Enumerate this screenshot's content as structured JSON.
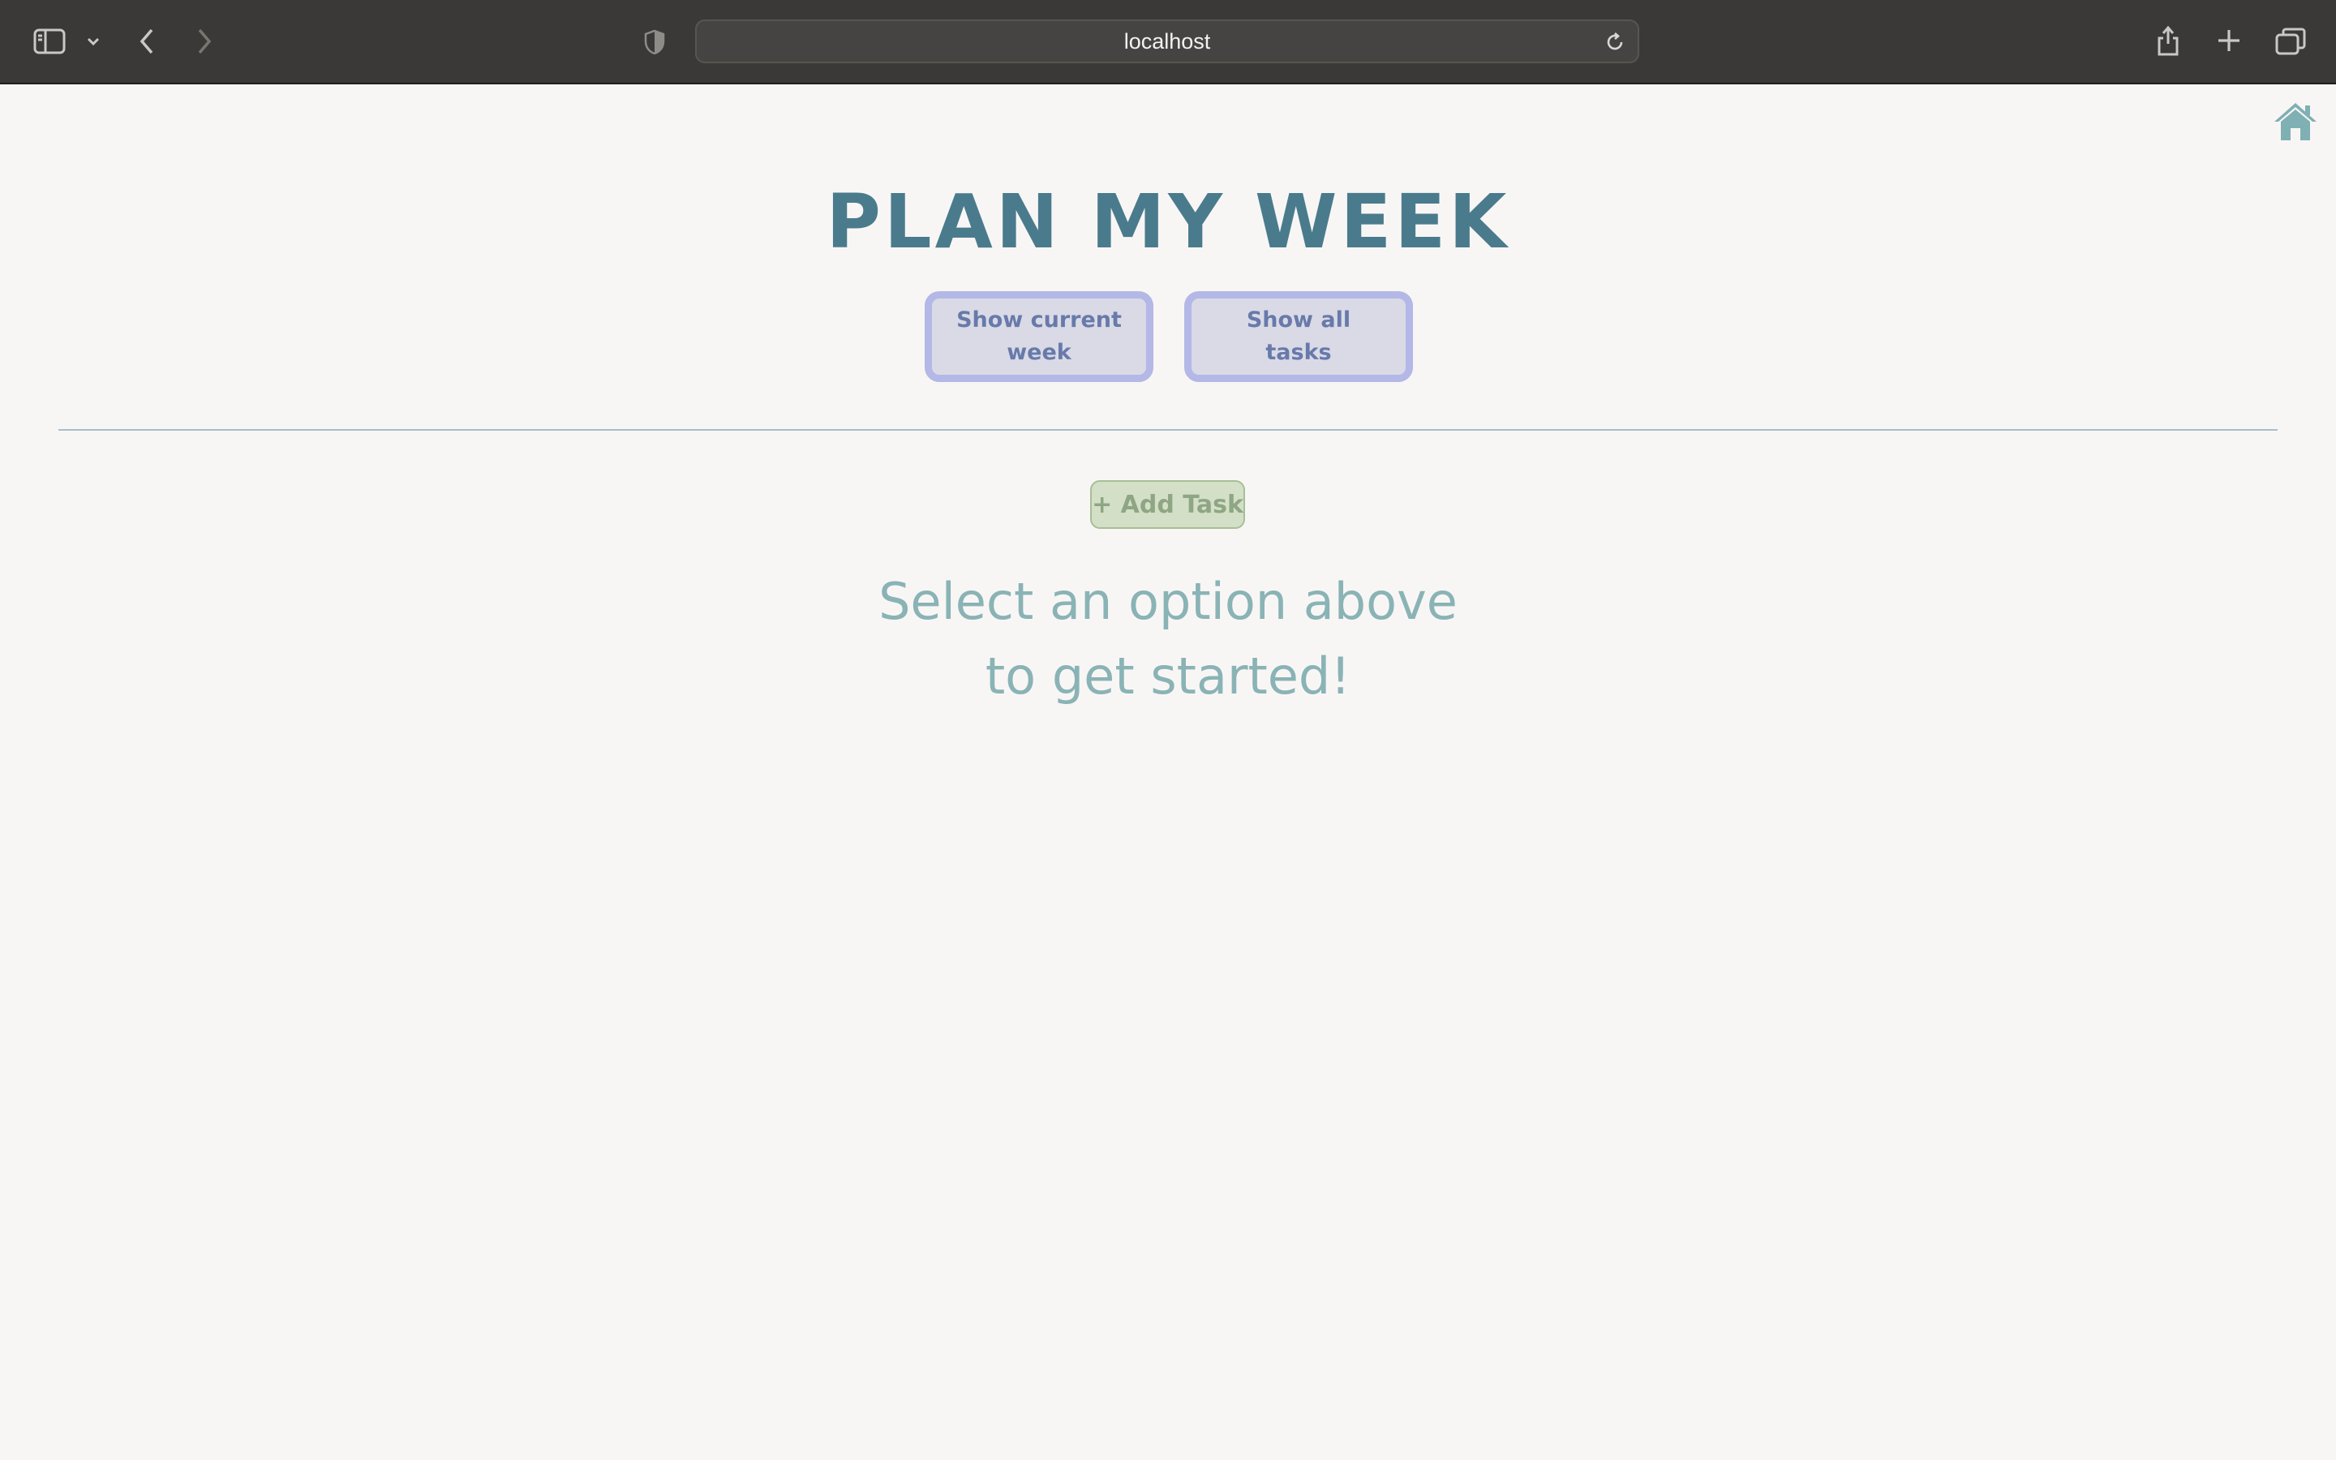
{
  "browser": {
    "url": "localhost",
    "icons": [
      "sidebar-icon",
      "chevron-down-icon",
      "back-icon",
      "forward-icon",
      "privacy-shield-icon",
      "reload-icon",
      "share-icon",
      "new-tab-icon",
      "tab-overview-icon"
    ]
  },
  "header": {
    "home_icon": "home-icon",
    "title": "PLAN MY WEEK"
  },
  "view_buttons": {
    "current_week": {
      "line1": "Show current",
      "line2": "week"
    },
    "all_tasks": {
      "line1": "Show all",
      "line2": "tasks"
    }
  },
  "add_task": {
    "label": "+ Add Task"
  },
  "empty_state": {
    "line1": "Select an option above",
    "line2": "to get started!"
  },
  "colors": {
    "title": "#4a7b8d",
    "view_button_border": "#b3b8e6",
    "view_button_text": "#687aaa",
    "add_task_bg": "#d4dfc7",
    "message": "#8ab3b5",
    "page_bg": "#f8f6f5"
  }
}
